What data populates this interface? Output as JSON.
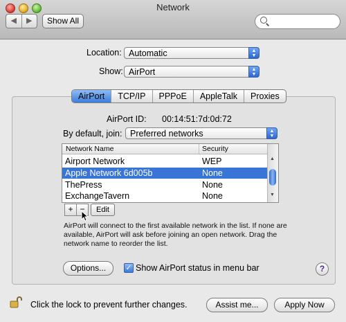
{
  "window": {
    "title": "Network"
  },
  "toolbar": {
    "show_all": "Show All",
    "back_glyph": "◀",
    "fwd_glyph": "▶"
  },
  "location": {
    "label": "Location:",
    "value": "Automatic"
  },
  "show": {
    "label": "Show:",
    "value": "AirPort"
  },
  "tabs": [
    "AirPort",
    "TCP/IP",
    "PPPoE",
    "AppleTalk",
    "Proxies"
  ],
  "airport_id": {
    "label": "AirPort ID:",
    "value": "00:14:51:7d:0d:72"
  },
  "join": {
    "label": "By default, join:",
    "value": "Preferred networks"
  },
  "network_table": {
    "headers": [
      "Network Name",
      "Security"
    ],
    "rows": [
      {
        "name": "Airport Network",
        "security": "WEP"
      },
      {
        "name": "Apple Network 6d005b",
        "security": "None",
        "selected": true
      },
      {
        "name": "ThePress",
        "security": "None"
      },
      {
        "name": "ExchangeTavern",
        "security": "None"
      }
    ]
  },
  "list_buttons": {
    "add": "+",
    "remove": "−",
    "edit": "Edit"
  },
  "help_text": "AirPort will connect to the first available network in the list. If none are available, AirPort will ask before joining an open network. Drag the network name to reorder the list.",
  "options_button": "Options...",
  "status_checkbox": {
    "label": "Show AirPort status in menu bar",
    "checked": true
  },
  "help_button": "?",
  "footer": {
    "lock_text": "Click the lock to prevent further changes.",
    "assist_button": "Assist me...",
    "apply_button": "Apply Now"
  },
  "colors": {
    "selection": "#3875d7",
    "accent_blue": "#3c7ddc"
  }
}
